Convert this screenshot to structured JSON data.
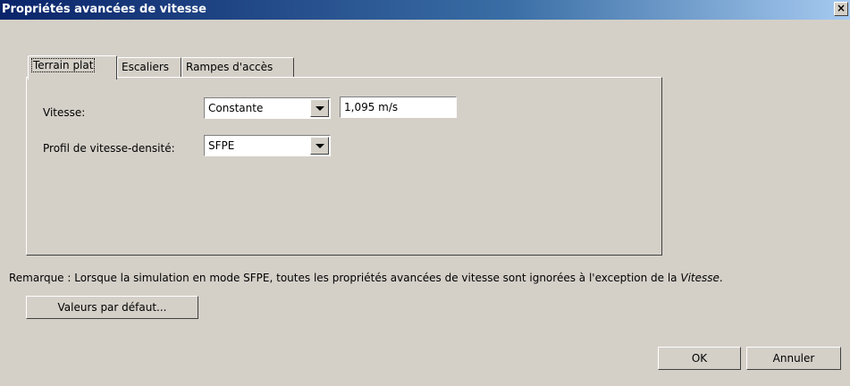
{
  "window": {
    "title": "Propriétés avancées de vitesse",
    "close_glyph": "×"
  },
  "tabs": [
    {
      "label": "Terrain plat",
      "active": true
    },
    {
      "label": "Escaliers",
      "active": false
    },
    {
      "label": "Rampes d'accès",
      "active": false
    }
  ],
  "speed": {
    "label": "Vitesse:",
    "mode": "Constante",
    "value": "1,095 m/s"
  },
  "profile": {
    "label": "Profil de vitesse-densité:",
    "value": "SFPE"
  },
  "note": {
    "prefix": "Remarque : Lorsque la simulation en mode SFPE, toutes les propriétés avancées de vitesse sont ignorées à l'exception de la ",
    "emphasis": "Vitesse",
    "suffix": "."
  },
  "buttons": {
    "defaults": "Valeurs par défaut...",
    "ok": "OK",
    "cancel": "Annuler"
  }
}
